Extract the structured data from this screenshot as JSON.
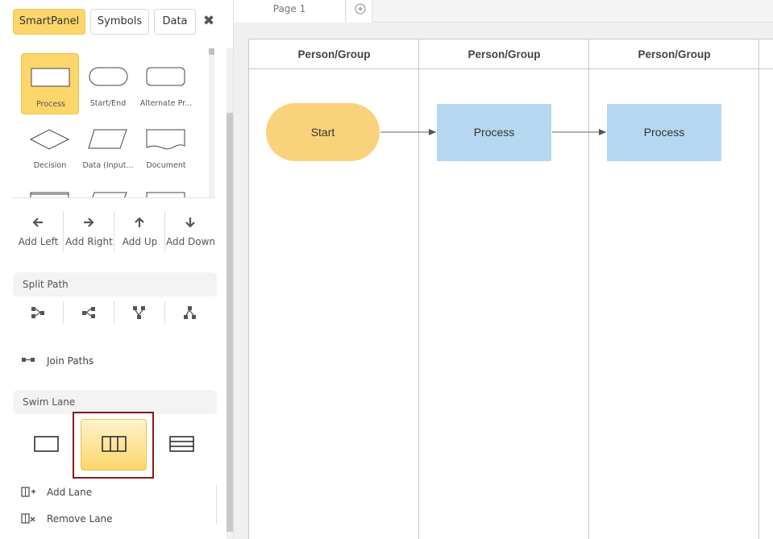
{
  "tabs": {
    "smartpanel": "SmartPanel",
    "symbols": "Symbols",
    "data": "Data",
    "close_symbol": "✖"
  },
  "shapes": [
    {
      "label": "Process",
      "icon": "process-rect-icon",
      "selected": true
    },
    {
      "label": "Start/End",
      "icon": "start-end-icon"
    },
    {
      "label": "Alternate Pr...",
      "icon": "alternate-process-icon"
    },
    {
      "label": "Decision",
      "icon": "decision-diamond-icon"
    },
    {
      "label": "Data (Input...",
      "icon": "data-parallelogram-icon"
    },
    {
      "label": "Document",
      "icon": "document-icon"
    }
  ],
  "directions": [
    {
      "label": "Add Left",
      "icon": "arrow-left-icon"
    },
    {
      "label": "Add Right",
      "icon": "arrow-right-icon"
    },
    {
      "label": "Add Up",
      "icon": "arrow-up-icon"
    },
    {
      "label": "Add Down",
      "icon": "arrow-down-icon"
    }
  ],
  "split_path": {
    "title": "Split Path",
    "join_paths": "Join Paths"
  },
  "swim_lane": {
    "title": "Swim Lane",
    "add_lane": "Add Lane",
    "remove_lane": "Remove Lane"
  },
  "page_tabs": {
    "page1": "Page 1"
  },
  "diagram": {
    "lanes": [
      "Person/Group",
      "Person/Group",
      "Person/Group"
    ],
    "start": "Start",
    "process1": "Process",
    "process2": "Process"
  },
  "colors": {
    "accent": "#fcd66a",
    "start_fill": "#fad27c",
    "process_fill": "#b5d7ef",
    "highlight": "#8b1a1a"
  }
}
